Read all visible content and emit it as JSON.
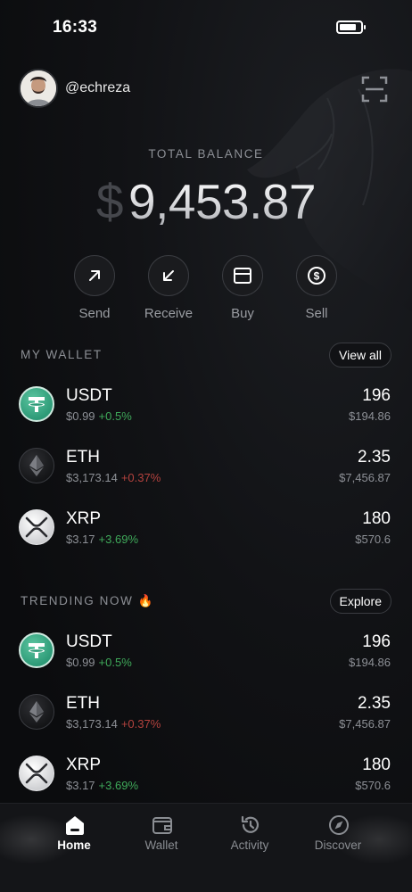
{
  "status_bar": {
    "time": "16:33",
    "battery_level": 0.8
  },
  "profile": {
    "username": "@echreza"
  },
  "balance": {
    "label": "TOTAL BALANCE",
    "currency_symbol": "$",
    "amount": "9,453.87"
  },
  "actions": [
    {
      "label": "Send",
      "icon": "arrow-up-right-icon"
    },
    {
      "label": "Receive",
      "icon": "arrow-down-left-icon"
    },
    {
      "label": "Buy",
      "icon": "card-icon"
    },
    {
      "label": "Sell",
      "icon": "dollar-coin-icon"
    }
  ],
  "my_wallet": {
    "title": "MY WALLET",
    "button_label": "View all",
    "assets": [
      {
        "symbol": "USDT",
        "price": "$0.99",
        "change": "+0.5%",
        "direction": "up",
        "quantity": "196",
        "value": "$194.86",
        "icon": "tether-icon"
      },
      {
        "symbol": "ETH",
        "price": "$3,173.14",
        "change": "+0.37%",
        "direction": "down",
        "quantity": "2.35",
        "value": "$7,456.87",
        "icon": "ethereum-icon"
      },
      {
        "symbol": "XRP",
        "price": "$3.17",
        "change": "+3.69%",
        "direction": "up",
        "quantity": "180",
        "value": "$570.6",
        "icon": "xrp-icon"
      }
    ]
  },
  "trending": {
    "title": "TRENDING NOW 🔥",
    "button_label": "Explore",
    "assets": [
      {
        "symbol": "USDT",
        "price": "$0.99",
        "change": "+0.5%",
        "direction": "up",
        "quantity": "196",
        "value": "$194.86",
        "icon": "tether-icon"
      },
      {
        "symbol": "ETH",
        "price": "$3,173.14",
        "change": "+0.37%",
        "direction": "down",
        "quantity": "2.35",
        "value": "$7,456.87",
        "icon": "ethereum-icon"
      },
      {
        "symbol": "XRP",
        "price": "$3.17",
        "change": "+3.69%",
        "direction": "up",
        "quantity": "180",
        "value": "$570.6",
        "icon": "xrp-icon"
      }
    ]
  },
  "tabs": [
    {
      "label": "Home",
      "icon": "home-icon",
      "active": true
    },
    {
      "label": "Wallet",
      "icon": "wallet-icon",
      "active": false
    },
    {
      "label": "Activity",
      "icon": "history-icon",
      "active": false
    },
    {
      "label": "Discover",
      "icon": "compass-icon",
      "active": false
    }
  ],
  "colors": {
    "background": "#0b0c0e",
    "positive": "#3fa95a",
    "negative": "#b3423e",
    "muted": "#8d9096"
  }
}
